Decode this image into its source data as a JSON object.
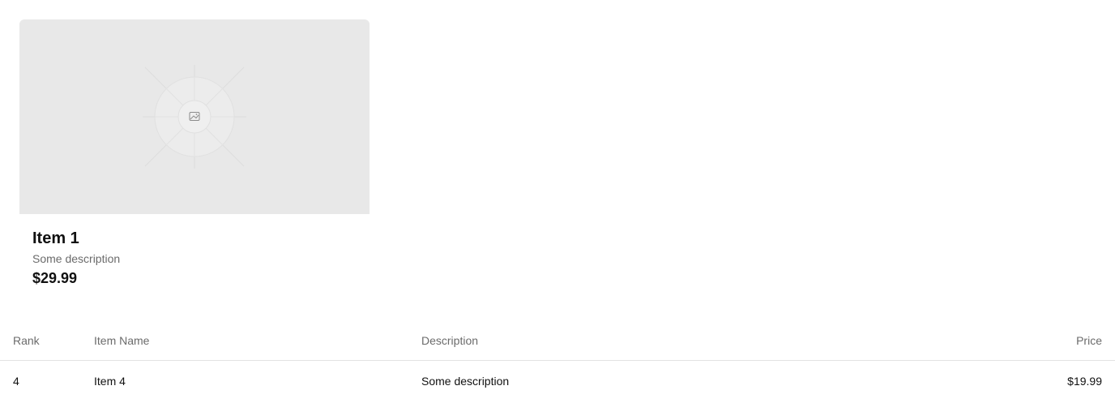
{
  "card": {
    "image_icon": "image-placeholder-icon",
    "title": "Item 1",
    "description": "Some description",
    "price": "$29.99"
  },
  "table": {
    "headers": {
      "rank": "Rank",
      "name": "Item Name",
      "description": "Description",
      "price": "Price"
    },
    "rows": [
      {
        "rank": "4",
        "name": "Item 4",
        "description": "Some description",
        "price": "$19.99"
      }
    ]
  },
  "colors": {
    "placeholder_bg": "#e8e8e8",
    "muted_text": "#6b6b6b",
    "text": "#111111",
    "divider": "#e2e2e2"
  }
}
